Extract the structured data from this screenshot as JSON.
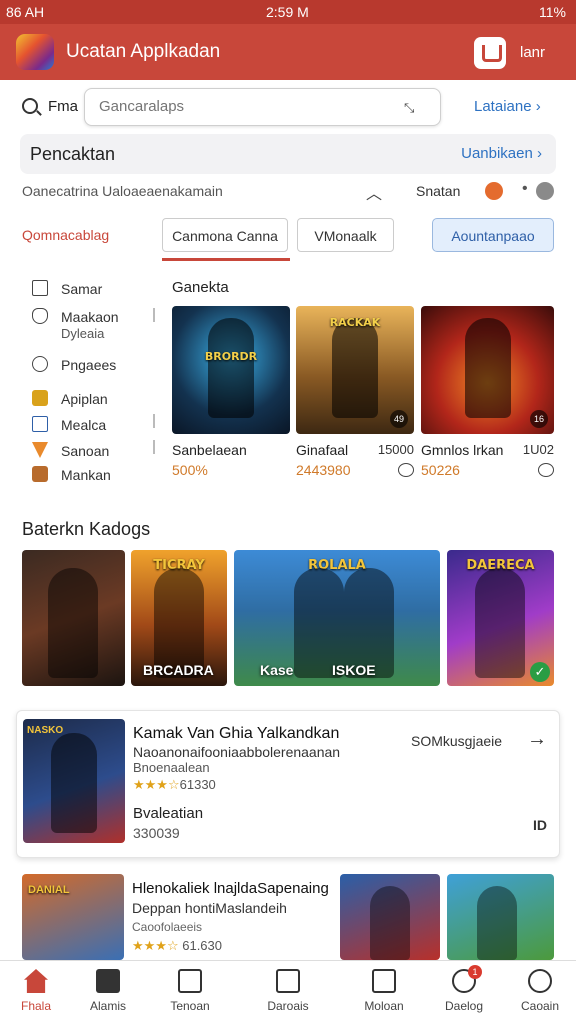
{
  "status_bar": {
    "left": "86 AH",
    "time": "2:59 M",
    "right": "11%"
  },
  "app_bar": {
    "title": "Ucatan Applkadan",
    "action_label": "lanr"
  },
  "search": {
    "prefix": "Fma",
    "placeholder": "Gancaralaps",
    "link": "Lataiane"
  },
  "section": {
    "title": "Pencaktan",
    "link": "Uanbikaen"
  },
  "sort": {
    "label": "Oanecatrina Ualoaeaenakamain",
    "value": "Snatan"
  },
  "chips": [
    "Qomnacablag",
    "Canmona Canna",
    "VMonaalk",
    "Aountanpaao"
  ],
  "sidebar": {
    "items": [
      {
        "label": "Samar",
        "sub": "",
        "icon": "calendar-icon"
      },
      {
        "label": "Maakaon",
        "sub": "Dyleaia",
        "icon": "shield-icon"
      },
      {
        "label": "Pngaees",
        "sub": "",
        "icon": "gear-icon"
      },
      {
        "label": "Apiplan",
        "sub": "",
        "icon": "gold-badge-icon"
      },
      {
        "label": "Mealca",
        "sub": "",
        "icon": "square-icon"
      },
      {
        "label": "Sanoan",
        "sub": "",
        "icon": "orange-triangle-icon"
      },
      {
        "label": "Mankan",
        "sub": "",
        "icon": "brown-box-icon"
      }
    ]
  },
  "grid": {
    "title": "Ganekta",
    "cards": [
      {
        "name": "Sanbelaean",
        "count": "",
        "price": "500%",
        "logo": "BRORDR",
        "badge": ""
      },
      {
        "name": "Ginafaal",
        "count": "15000",
        "price": "2443980",
        "logo": "RACKAK",
        "badge": "49"
      },
      {
        "name": "Gmnlos lrkan",
        "count": "1U02",
        "price": "50226",
        "logo": "",
        "badge": "16"
      }
    ]
  },
  "popular": {
    "title": "Baterkn Kadogs",
    "images": [
      {
        "caption": "",
        "logo": ""
      },
      {
        "caption": "BRCADRA",
        "logo": "TICRAY"
      },
      {
        "caption": "ISKOE",
        "caption2": "Kase",
        "logo": "ROLALA"
      },
      {
        "caption": "",
        "logo": "DAERECA"
      }
    ]
  },
  "featured": {
    "title": "Kamak Van Ghia Yalkandkan",
    "desc1": "Naoanonaifooniaabbolerenaanan",
    "desc2": "Bnoenaalean",
    "rating": "61330",
    "sub_title": "Bvaleatian",
    "sub_value": "330039",
    "right_text": "SOMkusgjaeie",
    "id_text": "ID",
    "logo": "NASKO"
  },
  "row2": {
    "title": "Hlenokaliek lnajldaSapenaing",
    "desc": "Deppan hontiMaslandeih",
    "desc2": "Caoofolaeeis",
    "rating": "61.630",
    "logo": "DANIAL"
  },
  "bottom_nav": [
    {
      "label": "Fhala",
      "active": true
    },
    {
      "label": "Alamis",
      "active": false
    },
    {
      "label": "Tenoan",
      "active": false
    },
    {
      "label": "Daroais",
      "active": false
    },
    {
      "label": "Moloan",
      "active": false
    },
    {
      "label": "Daelog",
      "active": false,
      "badge": "1"
    },
    {
      "label": "Caoain",
      "active": false
    }
  ],
  "colors": {
    "brand": "#c8473a",
    "link": "#2e72c2",
    "price": "#d07a2a",
    "chip_active_bg": "#e3eefc"
  }
}
